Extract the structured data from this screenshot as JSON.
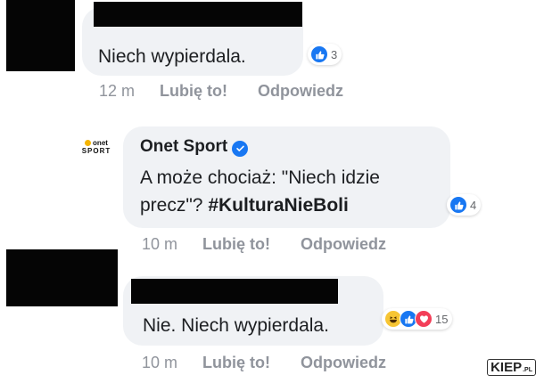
{
  "comments": [
    {
      "text": "Niech wypierdala.",
      "reaction_count": "3",
      "reactions": [
        "like-icon"
      ],
      "time": "12 m",
      "like_label": "Lubię to!",
      "reply_label": "Odpowiedz"
    },
    {
      "author": "Onet Sport",
      "text_line1": "A może chociaż: \"Niech idzie",
      "text_line2_prefix": "precz\"? ",
      "hashtag": "#KulturaNieBoli",
      "reaction_count": "4",
      "reactions": [
        "like-icon"
      ],
      "time": "10 m",
      "like_label": "Lubię to!",
      "reply_label": "Odpowiedz",
      "avatar": {
        "top": "onet",
        "bottom": "SPORT",
        "accent": "#f5b400"
      }
    },
    {
      "text": "Nie. Niech wypierdala.",
      "reaction_count": "15",
      "reactions": [
        "haha-icon",
        "like-icon",
        "love-icon"
      ],
      "time": "10 m",
      "like_label": "Lubię to!",
      "reply_label": "Odpowiedz"
    }
  ],
  "watermark": {
    "main": "KIEP",
    "suffix": ".PL"
  },
  "colors": {
    "like": "#1877f2",
    "love": "#f33e58",
    "haha": "#f7c533",
    "verified": "#1877f2",
    "bubble": "#f0f2f5",
    "meta": "#90949c"
  }
}
